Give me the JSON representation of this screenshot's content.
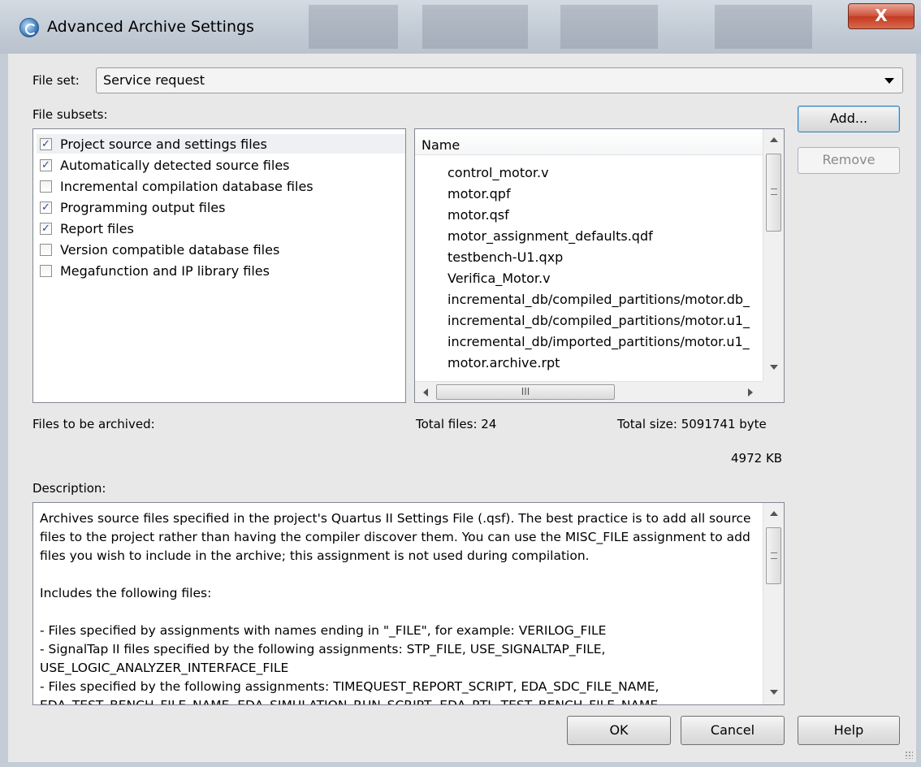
{
  "window": {
    "title": "Advanced Archive Settings",
    "close_glyph": "X"
  },
  "file_set": {
    "label": "File set:",
    "value": "Service request"
  },
  "file_subsets": {
    "label": "File subsets:",
    "items": [
      {
        "label": "Project source and settings files",
        "checked": true
      },
      {
        "label": "Automatically detected source files",
        "checked": true
      },
      {
        "label": "Incremental compilation database files",
        "checked": false
      },
      {
        "label": "Programming output files",
        "checked": true
      },
      {
        "label": "Report files",
        "checked": true
      },
      {
        "label": "Version compatible database files",
        "checked": false
      },
      {
        "label": "Megafunction and IP library files",
        "checked": false
      }
    ]
  },
  "file_list": {
    "header": "Name",
    "items": [
      "control_motor.v",
      "motor.qpf",
      "motor.qsf",
      "motor_assignment_defaults.qdf",
      "testbench-U1.qxp",
      "Verifica_Motor.v",
      "incremental_db/compiled_partitions/motor.db_",
      "incremental_db/compiled_partitions/motor.u1_",
      "incremental_db/imported_partitions/motor.u1_",
      "motor.archive.rpt"
    ]
  },
  "buttons": {
    "add": "Add...",
    "remove": "Remove",
    "ok": "OK",
    "cancel": "Cancel",
    "help": "Help"
  },
  "summary": {
    "files_to_be_archived_label": "Files to be archived:",
    "total_files": "Total files: 24",
    "total_size": "Total size: 5091741 byte",
    "total_kb": "4972 KB"
  },
  "description": {
    "label": "Description:",
    "text": "Archives source files specified in the project's Quartus II Settings File (.qsf). The best practice is to add all source files to the project rather than having the compiler discover them. You can use the MISC_FILE assignment to add files you wish to include in the archive; this assignment is not used during compilation.\n\nIncludes the following files:\n\n- Files specified by assignments with names ending in \"_FILE\", for example: VERILOG_FILE\n- SignalTap II files specified by the following assignments: STP_FILE, USE_SIGNALTAP_FILE, USE_LOGIC_ANALYZER_INTERFACE_FILE\n- Files specified by the following assignments: TIMEQUEST_REPORT_SCRIPT, EDA_SDC_FILE_NAME, EDA_TEST_BENCH_FILE_NAME, EDA_SIMULATION_RUN_SCRIPT, EDA_RTL_TEST_BENCH_FILE_NAME"
  },
  "scrollbar": {
    "hscroll_grip": "III"
  }
}
